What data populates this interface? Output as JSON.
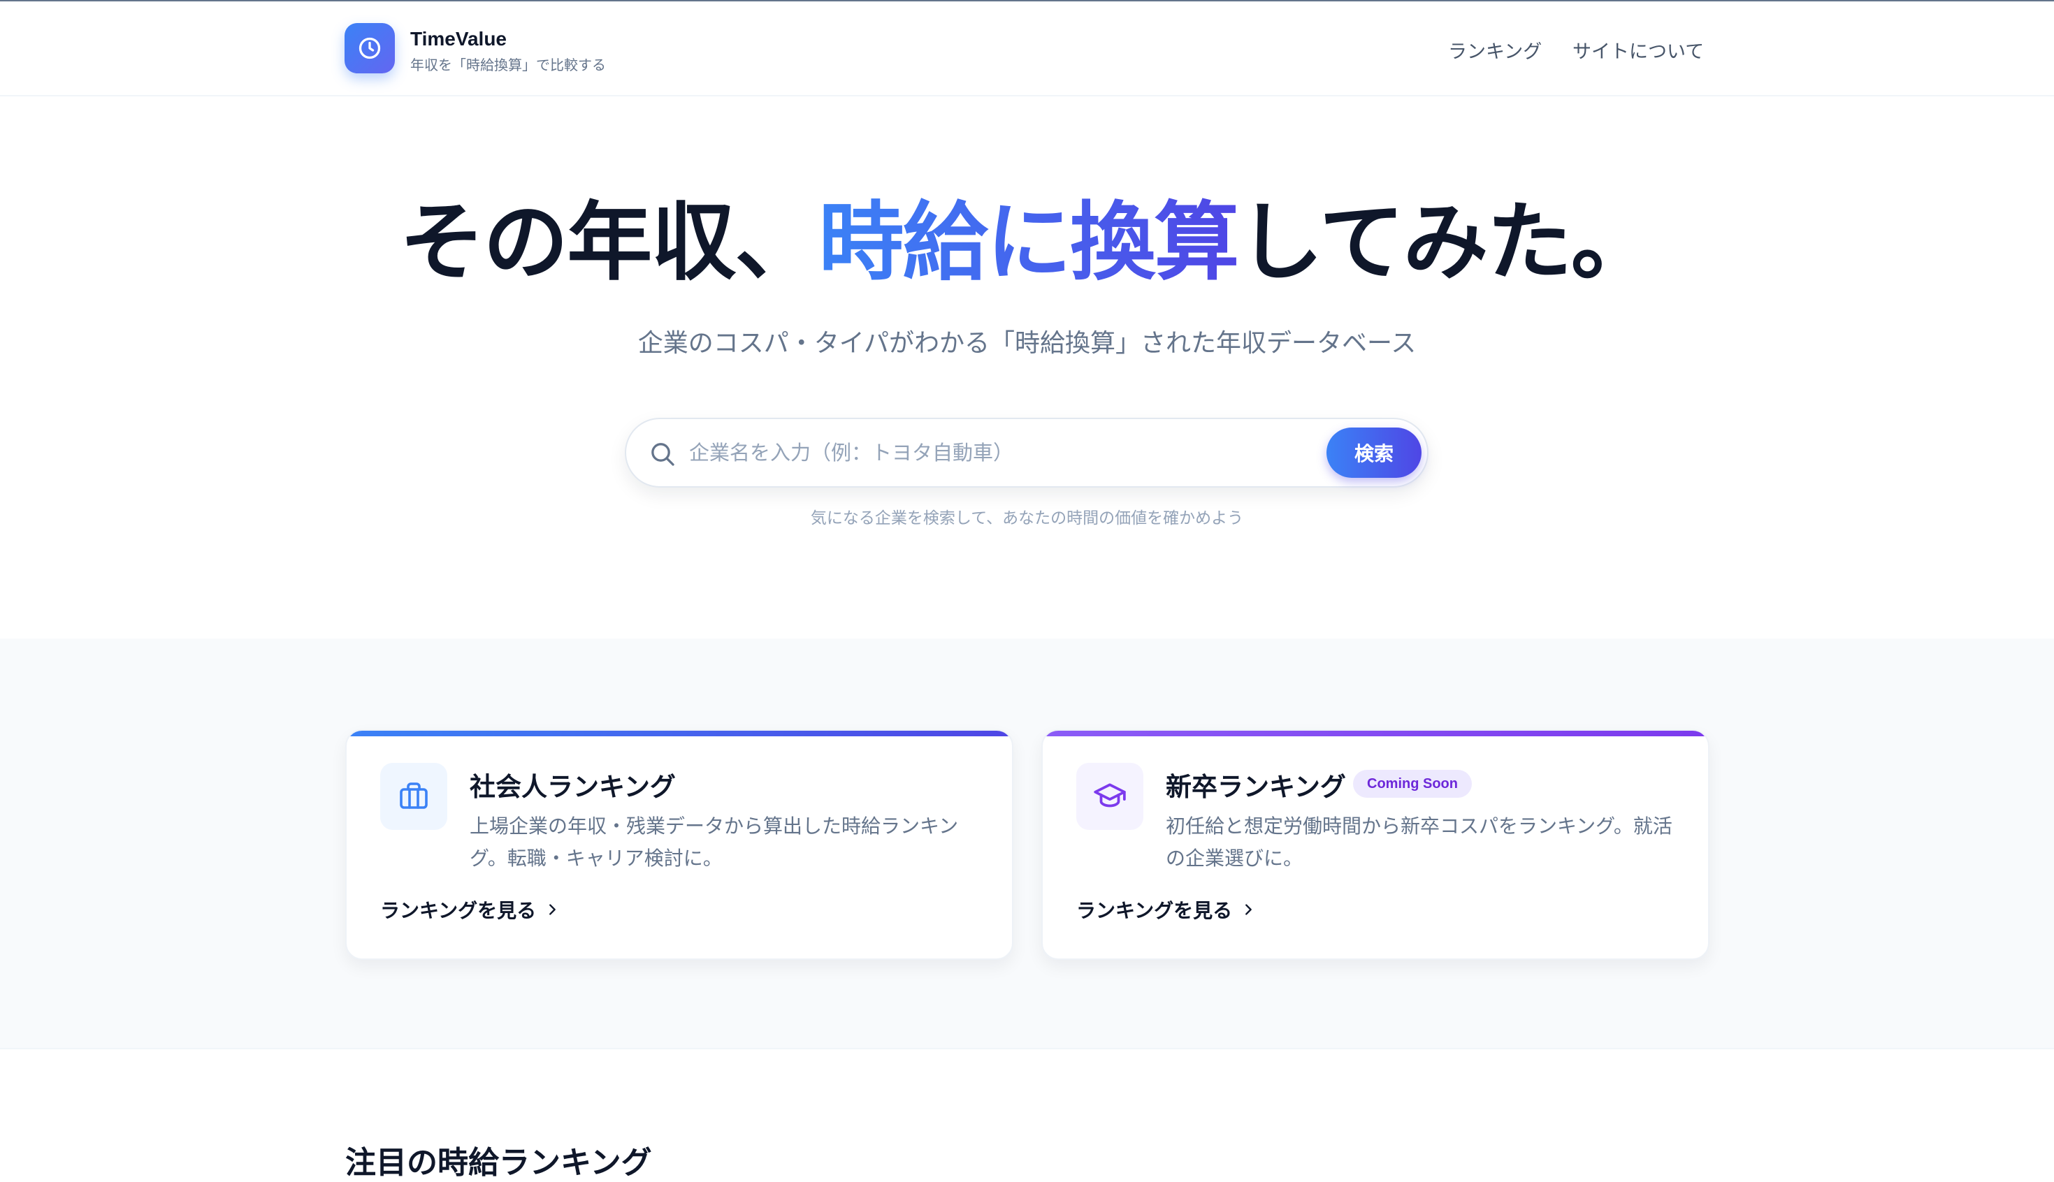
{
  "header": {
    "brand_name": "TimeValue",
    "brand_tagline": "年収を「時給換算」で比較する",
    "logo_icon": "clock-icon",
    "nav": [
      {
        "label": "ランキング"
      },
      {
        "label": "サイトについて"
      }
    ]
  },
  "hero": {
    "title_before": "その年収、",
    "title_highlight": "時給に換算",
    "title_after": "してみた。",
    "subtitle": "企業のコスパ・タイパがわかる「時給換算」された年収データベース"
  },
  "search": {
    "placeholder": "企業名を入力（例：トヨタ自動車）",
    "value": "",
    "button_label": "検索",
    "hint": "気になる企業を検索して、あなたの時間の価値を確かめよう",
    "icon": "search-icon"
  },
  "cards": [
    {
      "title": "社会人ランキング",
      "icon": "briefcase-icon",
      "description": "上場企業の年収・残業データから算出した時給ランキング。転職・キャリア検討に。",
      "link_label": "ランキングを見る",
      "accent": "#3b82f6"
    },
    {
      "title": "新卒ランキング",
      "badge": "Coming Soon",
      "icon": "graduation-cap-icon",
      "description": "初任給と想定労働時間から新卒コスパをランキング。就活の企業選びに。",
      "link_label": "ランキングを見る",
      "accent": "#7c3aed"
    }
  ],
  "featured": {
    "title": "注目の時給ランキング"
  }
}
